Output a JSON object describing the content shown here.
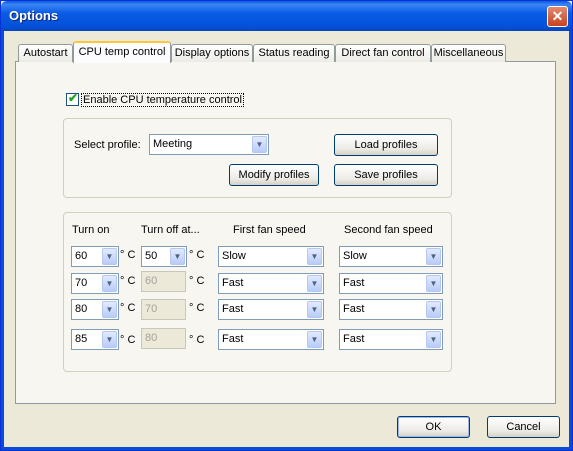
{
  "window": {
    "title": "Options",
    "close_glyph": "✕"
  },
  "tabs": [
    {
      "label": "Autostart"
    },
    {
      "label": "CPU temp control"
    },
    {
      "label": "Display options"
    },
    {
      "label": "Status reading"
    },
    {
      "label": "Direct fan control"
    },
    {
      "label": "Miscellaneous"
    }
  ],
  "enable_checkbox": {
    "label": "Enable CPU temperature control",
    "checked": true,
    "check_glyph": "✔"
  },
  "profile": {
    "select_label": "Select profile:",
    "selected": "Meeting",
    "load_button": "Load profiles",
    "modify_button": "Modify profiles",
    "save_button": "Save profiles"
  },
  "table": {
    "headers": {
      "turn_on": "Turn on",
      "turn_off": "Turn off at...",
      "first_fan": "First fan speed",
      "second_fan": "Second fan speed"
    },
    "unit": "° C",
    "rows": [
      {
        "turn_on": "60",
        "turn_off": "50",
        "turn_off_enabled": true,
        "first": "Slow",
        "second": "Slow"
      },
      {
        "turn_on": "70",
        "turn_off": "60",
        "turn_off_enabled": false,
        "first": "Fast",
        "second": "Fast"
      },
      {
        "turn_on": "80",
        "turn_off": "70",
        "turn_off_enabled": false,
        "first": "Fast",
        "second": "Fast"
      },
      {
        "turn_on": "85",
        "turn_off": "80",
        "turn_off_enabled": false,
        "first": "Fast",
        "second": "Fast"
      }
    ]
  },
  "footer": {
    "ok": "OK",
    "cancel": "Cancel"
  },
  "icons": {
    "dropdown": "chevron-down-icon",
    "close": "close-icon",
    "check": "checkmark-icon"
  },
  "colors": {
    "titlebar": "#0a5ce6",
    "dialog_bg": "#ece9d8",
    "panel_bg": "#f7f6f1",
    "close_button": "#c9411f",
    "tab_highlight": "#ffc83c"
  }
}
